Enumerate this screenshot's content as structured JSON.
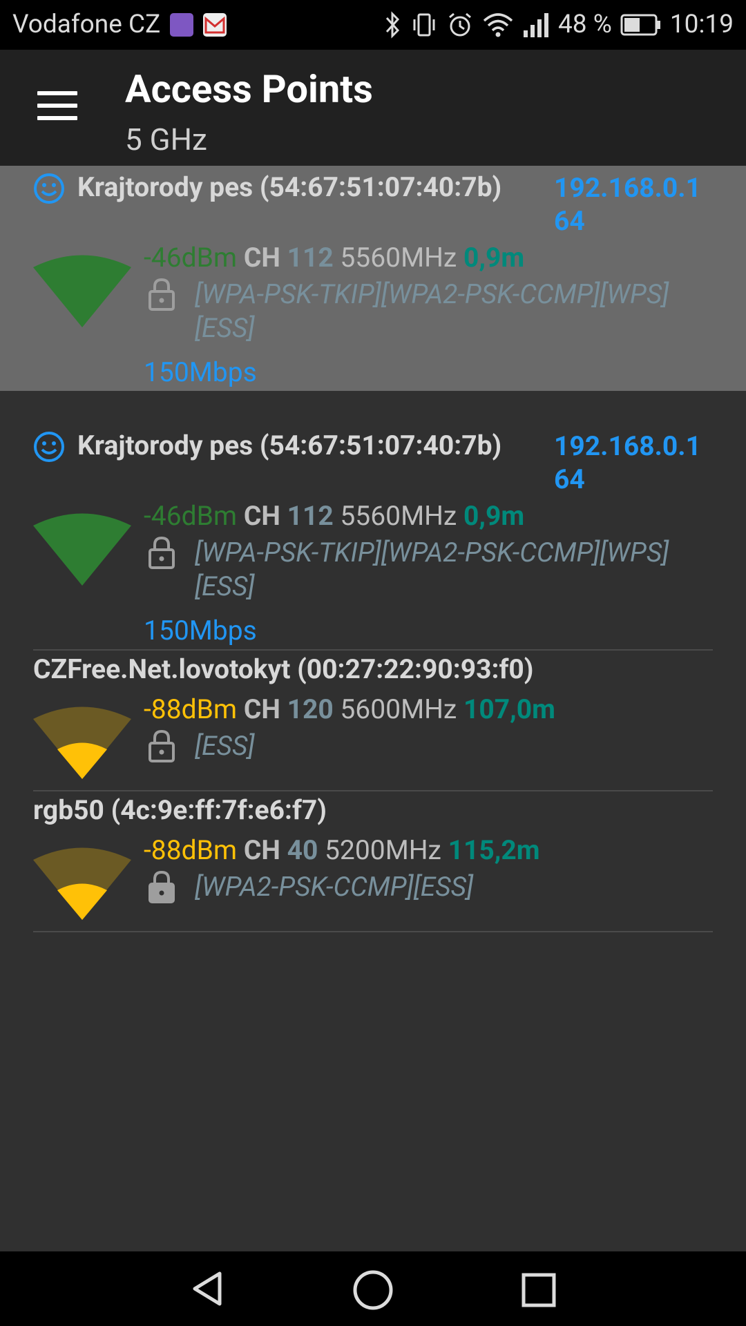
{
  "status_bar": {
    "carrier": "Vodafone CZ",
    "notification_icons": [
      "gallery-icon",
      "gmail-icon"
    ],
    "system_icons": [
      "bluetooth-icon",
      "vibrate-icon",
      "alarm-icon",
      "wifi-icon",
      "signal-icon"
    ],
    "battery": "48 %",
    "time": "10:19"
  },
  "app_bar": {
    "title": "Access Points",
    "subtitle": "5 GHz"
  },
  "access_points": [
    {
      "ssid": "Krajtorody pes (54:67:51:07:40:7b)",
      "connected": true,
      "ip_line1": "192.168.0.1",
      "ip_line2": "64",
      "level": "-46dBm",
      "ch_label": "CH",
      "channel": "112",
      "frequency": "5560MHz",
      "distance": "0,9m",
      "capabilities_line1": "[WPA-PSK-TKIP][WPA2-PSK-CCMP][WPS]",
      "capabilities_line2": "[ESS]",
      "speed": "150Mbps",
      "signal_fraction": 1.0,
      "selected": true
    },
    {
      "ssid": "Krajtorody pes (54:67:51:07:40:7b)",
      "connected": true,
      "ip_line1": "192.168.0.1",
      "ip_line2": "64",
      "level": "-46dBm",
      "ch_label": "CH",
      "channel": "112",
      "frequency": "5560MHz",
      "distance": "0,9m",
      "capabilities_line1": "[WPA-PSK-TKIP][WPA2-PSK-CCMP][WPS]",
      "capabilities_line2": "[ESS]",
      "speed": "150Mbps",
      "signal_fraction": 1.0,
      "selected": false
    },
    {
      "ssid": "CZFree.Net.lovotokyt (00:27:22:90:93:f0)",
      "connected": false,
      "level": "-88dBm",
      "ch_label": "CH",
      "channel": "120",
      "frequency": "5600MHz",
      "distance": "107,0m",
      "capabilities_line1": "[ESS]",
      "signal_fraction": 0.25,
      "selected": false
    },
    {
      "ssid": "rgb50 (4c:9e:ff:7f:e6:f7)",
      "connected": false,
      "level": "-88dBm",
      "ch_label": "CH",
      "channel": "40",
      "frequency": "5200MHz",
      "distance": "115,2m",
      "capabilities_line1": "[WPA2-PSK-CCMP][ESS]",
      "signal_fraction": 0.25,
      "selected": false
    }
  ],
  "nav_bar": {
    "buttons": [
      "back-icon",
      "home-icon",
      "recents-icon"
    ]
  },
  "colors": {
    "strong_signal": "#2e7d32",
    "weak_signal": "#ffc107",
    "weak_signal_bg": "#6b5a24",
    "accent_blue": "#2196f3",
    "channel_gray": "#78909c",
    "distance_teal": "#00897b"
  }
}
